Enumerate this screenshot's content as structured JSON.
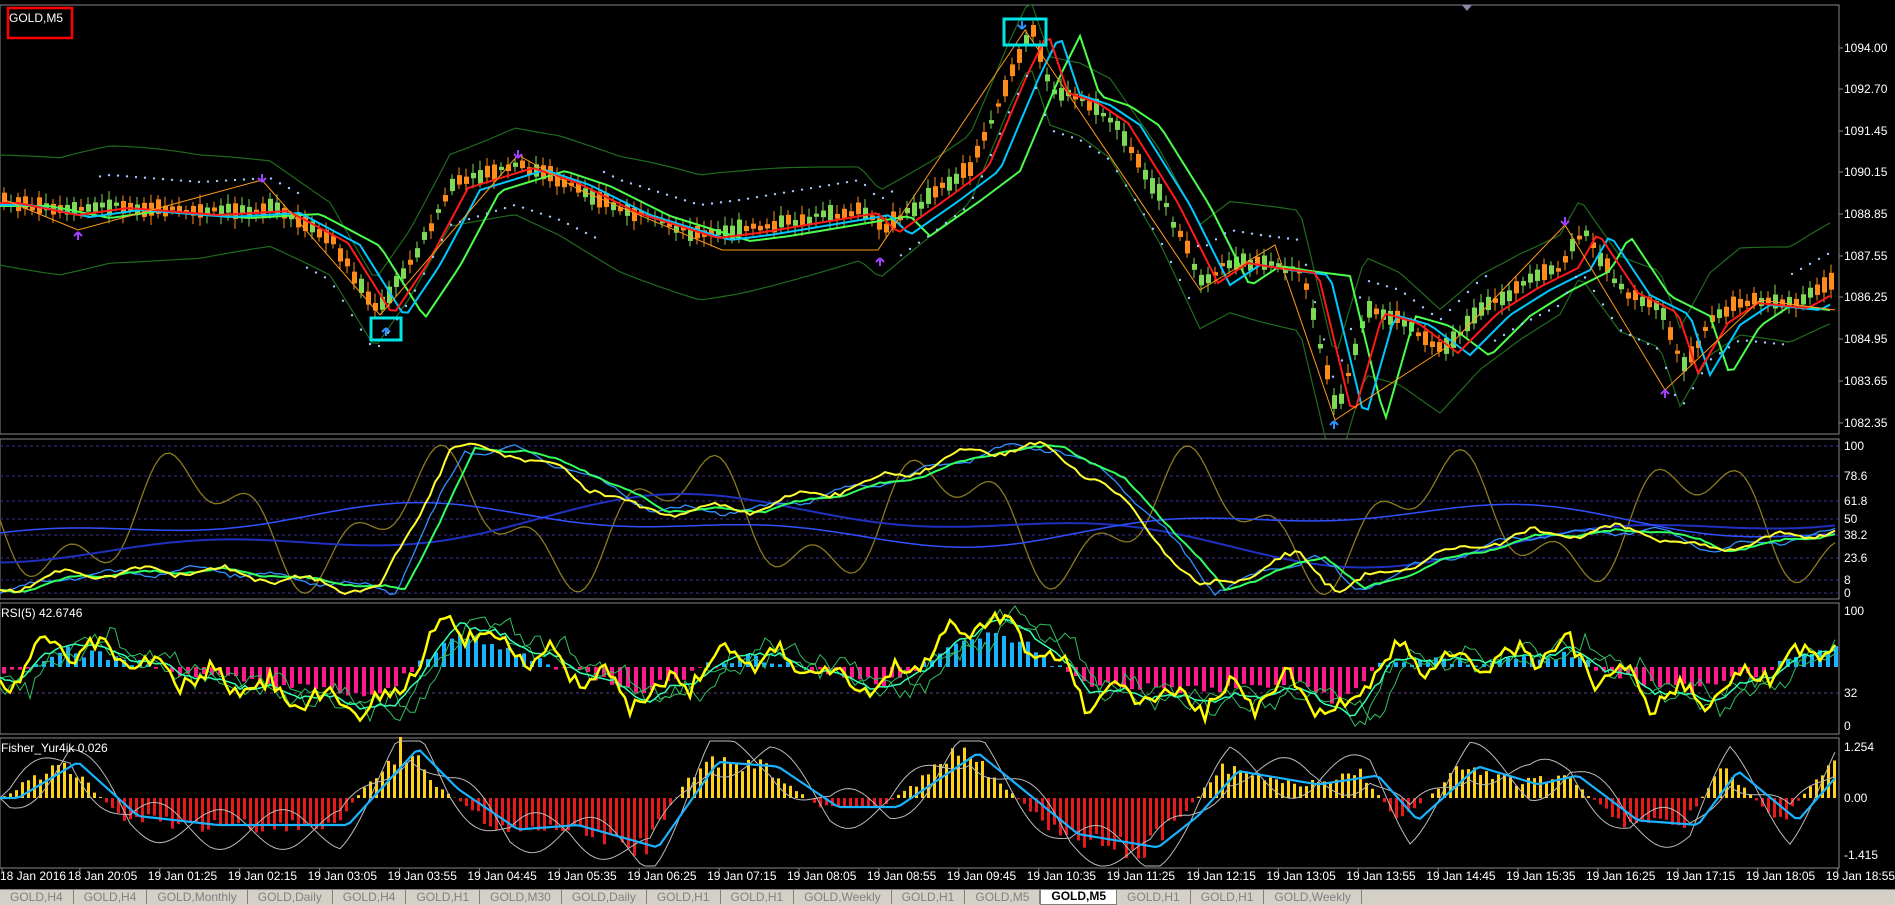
{
  "symbol_label": "GOLD,M5",
  "rsi_label": "RSI(5) 42.6746",
  "fisher_label": "Fisher_Yur4ik 0.026",
  "price_axis": [
    "1094.00",
    "1092.70",
    "1091.45",
    "1090.15",
    "1088.85",
    "1087.55",
    "1086.25",
    "1084.95",
    "1083.65",
    "1082.35"
  ],
  "stoch_axis": [
    "100",
    "78.6",
    "61.8",
    "50",
    "38.2",
    "23.6",
    "8",
    "0"
  ],
  "rsi_axis": [
    "100",
    "32",
    "0"
  ],
  "fisher_axis": [
    "1.254",
    "0.00",
    "-1.415"
  ],
  "time_axis": [
    "18 Jan 2016",
    "18 Jan 20:05",
    "19 Jan 01:25",
    "19 Jan 02:15",
    "19 Jan 03:05",
    "19 Jan 03:55",
    "19 Jan 04:45",
    "19 Jan 05:35",
    "19 Jan 06:25",
    "19 Jan 07:15",
    "19 Jan 08:05",
    "19 Jan 08:55",
    "19 Jan 09:45",
    "19 Jan 10:35",
    "19 Jan 11:25",
    "19 Jan 12:15",
    "19 Jan 13:05",
    "19 Jan 13:55",
    "19 Jan 14:45",
    "19 Jan 15:35",
    "19 Jan 16:25",
    "19 Jan 17:15",
    "19 Jan 18:05",
    "19 Jan 18:55"
  ],
  "tabs": [
    {
      "label": "GOLD,H4",
      "active": false
    },
    {
      "label": "GOLD,H4",
      "active": false
    },
    {
      "label": "GOLD,Monthly",
      "active": false
    },
    {
      "label": "GOLD,Daily",
      "active": false
    },
    {
      "label": "GOLD,H4",
      "active": false
    },
    {
      "label": "GOLD,H1",
      "active": false
    },
    {
      "label": "GOLD,M30",
      "active": false
    },
    {
      "label": "GOLD,Daily",
      "active": false
    },
    {
      "label": "GOLD,H1",
      "active": false
    },
    {
      "label": "GOLD,H1",
      "active": false
    },
    {
      "label": "GOLD,Weekly",
      "active": false
    },
    {
      "label": "GOLD,H1",
      "active": false
    },
    {
      "label": "GOLD,M5",
      "active": false
    },
    {
      "label": "GOLD,M5",
      "active": true
    },
    {
      "label": "GOLD,H1",
      "active": false
    },
    {
      "label": "GOLD,H1",
      "active": false
    },
    {
      "label": "GOLD,Weekly",
      "active": false
    }
  ],
  "colors": {
    "background": "#000000",
    "bull_candle": "#7ed957",
    "bear_candle": "#ff8c1a",
    "ma_red": "#ff1a1a",
    "ma_blue": "#00c8ff",
    "ma_green": "#4cff4c",
    "bollinger": "#1f6b1f",
    "zigzag": "#ff9a1a",
    "psar": "#9ec8ff",
    "highlight_box": "#00e5e5",
    "symbol_box": "#ff0000",
    "rsi_line": "#ffff00",
    "hist_pos": "#1ab2ff",
    "hist_neg": "#ff1a8c",
    "fisher_pos": "#ffd21a",
    "fisher_neg": "#e61a1a"
  }
}
